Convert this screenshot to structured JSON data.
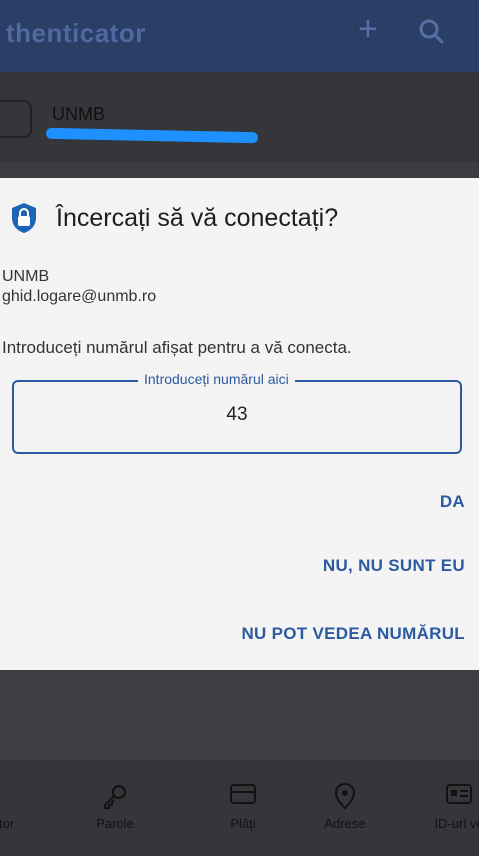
{
  "appbar": {
    "title": "thenticator",
    "add_icon": "plus-icon",
    "search_icon": "search-icon"
  },
  "account": {
    "name": "UNMB"
  },
  "dialog": {
    "icon": "lock-shield-icon",
    "title": "Încercați să vă conectați?",
    "account_label": "UNMB",
    "account_email": "ghid.logare@unmb.ro",
    "instruction": "Introduceți numărul afișat pentru a vă conecta.",
    "number_field_label": "Introduceți numărul aici",
    "number_value": "43",
    "action_yes": "DA",
    "action_no": "NU, NU SUNT EU",
    "action_cant_see": "NU POT VEDEA NUMĂRUL"
  },
  "bottom_nav": {
    "items": [
      {
        "label": "ator",
        "icon": "lock-icon"
      },
      {
        "label": "Parole",
        "icon": "key-icon"
      },
      {
        "label": "Plăți",
        "icon": "card-icon"
      },
      {
        "label": "Adrese",
        "icon": "location-icon"
      },
      {
        "label": "ID-uri ve",
        "icon": "id-card-icon"
      }
    ]
  },
  "colors": {
    "accent": "#2c5aa0",
    "appbar": "#2a3e66",
    "redaction": "#1e90ff"
  }
}
